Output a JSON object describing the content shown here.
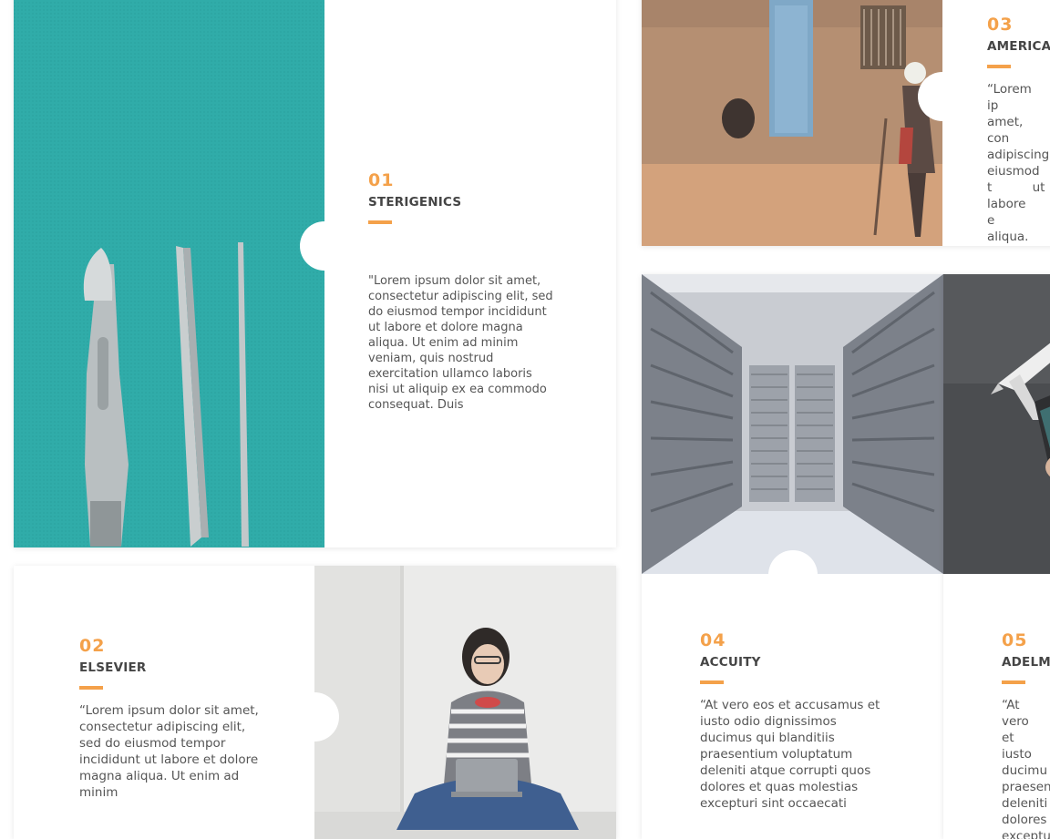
{
  "accent_color": "#f4a14a",
  "cards": [
    {
      "number": "01",
      "title": "STERIGENICS",
      "text": "\"Lorem ipsum dolor sit amet, consectetur adipiscing elit, sed do eiusmod tempor incididunt ut labore et dolore magna aliqua. Ut enim ad minim veniam, quis nostrud exercitation ullamco laboris nisi ut aliquip ex ea commodo consequat. Duis",
      "image": "surgical-instruments-photo"
    },
    {
      "number": "02",
      "title": "ELSEVIER",
      "text": "“Lorem ipsum dolor sit amet, consectetur adipiscing elit, sed do eiusmod tempor incididunt ut labore et dolore magna aliqua. Ut enim ad minim",
      "image": "woman-with-laptop-photo"
    },
    {
      "number": "03",
      "title": "AMERICA",
      "text": "“Lorem ip amet, con adipiscing eiusmod t ut labore e aliqua. Ut",
      "image": "elderly-man-village-photo"
    },
    {
      "number": "04",
      "title": "ACCUITY",
      "text": "“At vero eos et accusamus et iusto odio dignissimos ducimus qui blanditiis praesentium voluptatum deleniti atque corrupti quos dolores et quas molestias excepturi sint occaecati",
      "image": "server-room-photo"
    },
    {
      "number": "05",
      "title": "ADELMA",
      "text": "“At vero et iusto ducimu praesen deleniti dolores exceptu",
      "image": "phone-airplane-photo"
    }
  ]
}
